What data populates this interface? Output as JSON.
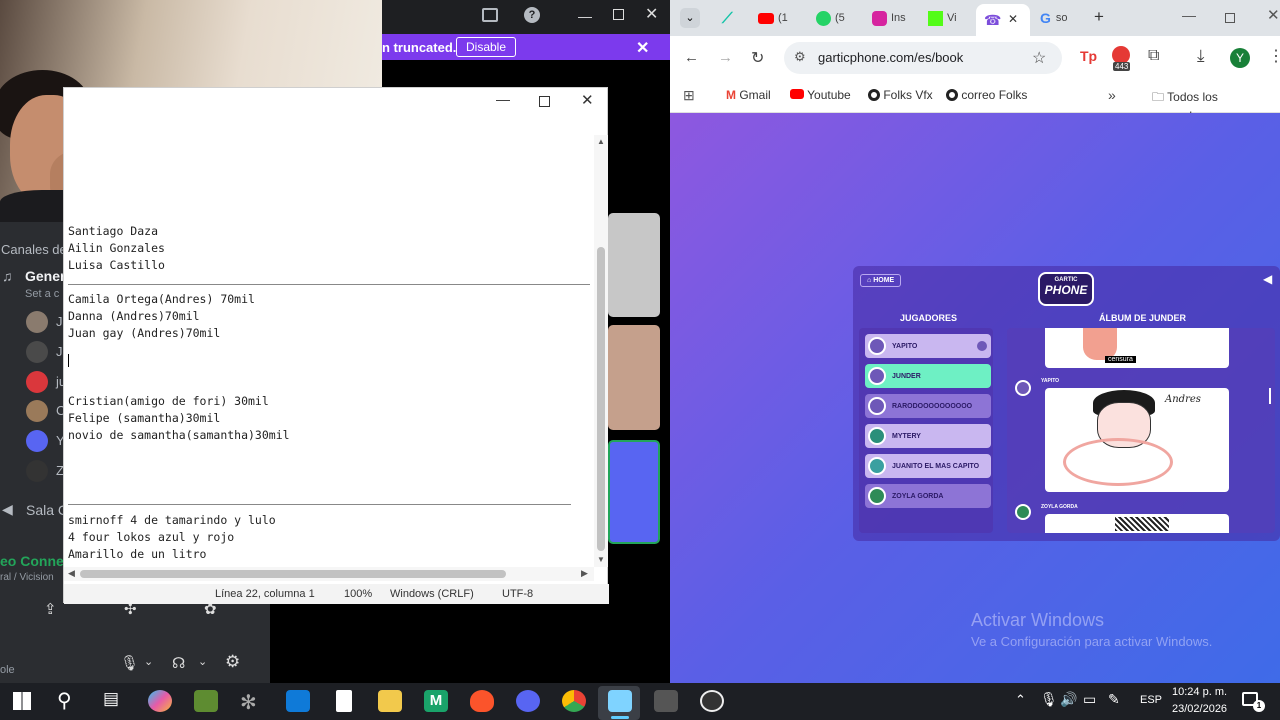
{
  "discord": {
    "banner_text": "n truncated.",
    "banner_button": "Disable",
    "channels_header": "Canales de",
    "general_channel": "Gener",
    "set_status": "Set a c",
    "sala_label": "Sala C",
    "connection_label": "eo Connec",
    "connection_sub": "ral / Vicision",
    "bottom_label": "ole",
    "list_letters": [
      "J",
      "J",
      "ju",
      "C",
      "Y",
      "Z"
    ]
  },
  "notepad": {
    "lines": [
      "Santiago Daza",
      "Ailin Gonzales",
      "Luisa Castillo",
      "",
      "Camila Ortega(Andres) 70mil",
      "Danna (Andres)70mil",
      "Juan gay (Andres)70mil",
      "",
      "",
      "",
      "Cristian(amigo de fori) 30mil",
      "Felipe (samantha)30mil",
      "novio de samantha(samantha)30mil",
      "",
      "",
      "",
      "",
      "smirnoff 4 de tamarindo y lulo",
      "4 four lokos azul y rojo",
      "Amarillo de un litro"
    ],
    "status": {
      "position": "Línea 22, columna 1",
      "zoom": "100%",
      "line_ending": "Windows (CRLF)",
      "encoding": "UTF-8"
    }
  },
  "chrome": {
    "tabs": [
      {
        "label": "(1"
      },
      {
        "label": "(5"
      },
      {
        "label": "Ins"
      },
      {
        "label": "Vi"
      },
      {
        "label": ""
      },
      {
        "label": "so"
      }
    ],
    "url": "garticphone.com/es/book",
    "extension_badge": "443",
    "profile_letter": "Y",
    "bookmarks": [
      "Gmail",
      "Youtube",
      "Folks Vfx",
      "correo Folks"
    ],
    "all_bookmarks": "Todos los marcadores"
  },
  "game": {
    "home_label": "HOME",
    "logo_top": "GARTIC",
    "logo_bottom": "PHONE",
    "players_title": "JUGADORES",
    "album_title": "ÁLBUM DE JUNDER",
    "players": [
      {
        "name": "YAPITO",
        "active": false
      },
      {
        "name": "JUNDER",
        "active": true
      },
      {
        "name": "RARODOOOOOOOOOO",
        "active": false
      },
      {
        "name": "MYTERY",
        "active": false
      },
      {
        "name": "JUANITO EL MAS CAPITO",
        "active": false
      },
      {
        "name": "ZOYLA GORDA",
        "active": false
      }
    ],
    "album_entries": [
      {
        "author": "",
        "caption": "censura"
      },
      {
        "author": "YAPITO",
        "caption": "Andres"
      },
      {
        "author": "ZOYLA GORDA",
        "caption": ""
      }
    ]
  },
  "watermark": {
    "title": "Activar Windows",
    "subtitle": "Ve a Configuración para activar Windows."
  },
  "taskbar": {
    "language": "ESP",
    "time": "10:24 p. m.",
    "date": "23/02/2026",
    "notification_count": "1"
  }
}
